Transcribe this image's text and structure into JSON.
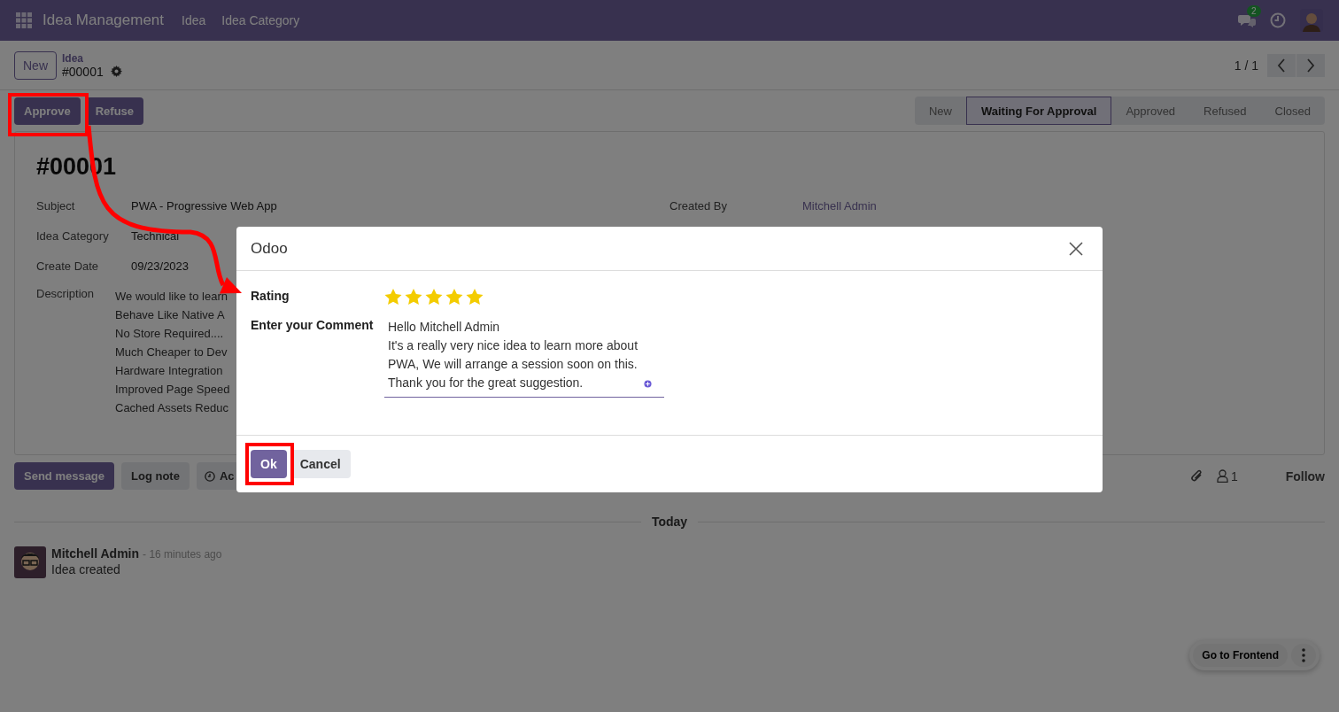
{
  "navbar": {
    "app_title": "Idea Management",
    "menu": [
      "Idea",
      "Idea Category"
    ],
    "messages_badge": "2"
  },
  "breadcrumb": {
    "new_button": "New",
    "parent": "Idea",
    "record": "#00001"
  },
  "pager": {
    "text": "1 / 1"
  },
  "actions": [
    "Approve",
    "Refuse"
  ],
  "stages": [
    {
      "label": "New",
      "selected": false
    },
    {
      "label": "Waiting For Approval",
      "selected": true
    },
    {
      "label": "Approved",
      "selected": false
    },
    {
      "label": "Refused",
      "selected": false
    },
    {
      "label": "Closed",
      "selected": false
    }
  ],
  "form": {
    "title": "#00001",
    "created_by": {
      "label": "Created By",
      "value": "Mitchell Admin"
    },
    "fields": [
      {
        "label": "Subject",
        "value": "PWA - Progressive Web App"
      },
      {
        "label": "Idea Category",
        "value": "Technical"
      },
      {
        "label": "Create Date",
        "value": "09/23/2023"
      }
    ],
    "description": {
      "label": "Description",
      "lines": [
        "We would like to learn",
        "Behave Like Native A",
        "No Store Required....",
        "Much Cheaper to Dev",
        "Hardware Integration",
        "Improved Page Speed",
        "Cached Assets Reduc"
      ]
    }
  },
  "chatter": {
    "buttons": [
      {
        "label": "Send message",
        "kind": "primary"
      },
      {
        "label": "Log note",
        "kind": "secondary"
      }
    ],
    "activities": "Ac",
    "followers": "1",
    "follow": "Follow",
    "divider": "Today",
    "messages": [
      {
        "author": "Mitchell Admin",
        "time": "- 16 minutes ago",
        "body": "Idea created"
      }
    ]
  },
  "dialog": {
    "title": "Odoo",
    "rating_label": "Rating",
    "stars": 5,
    "comment_label": "Enter your Comment",
    "comment": "Hello Mitchell Admin\nIt's a really very nice idea to learn more about\nPWA, We will arrange a session soon on this.\nThank you for the great suggestion.",
    "buttons": [
      {
        "label": "Ok",
        "kind": "primary"
      },
      {
        "label": "Cancel",
        "kind": "secondary"
      }
    ]
  },
  "floating": {
    "button": "Go to Frontend"
  }
}
